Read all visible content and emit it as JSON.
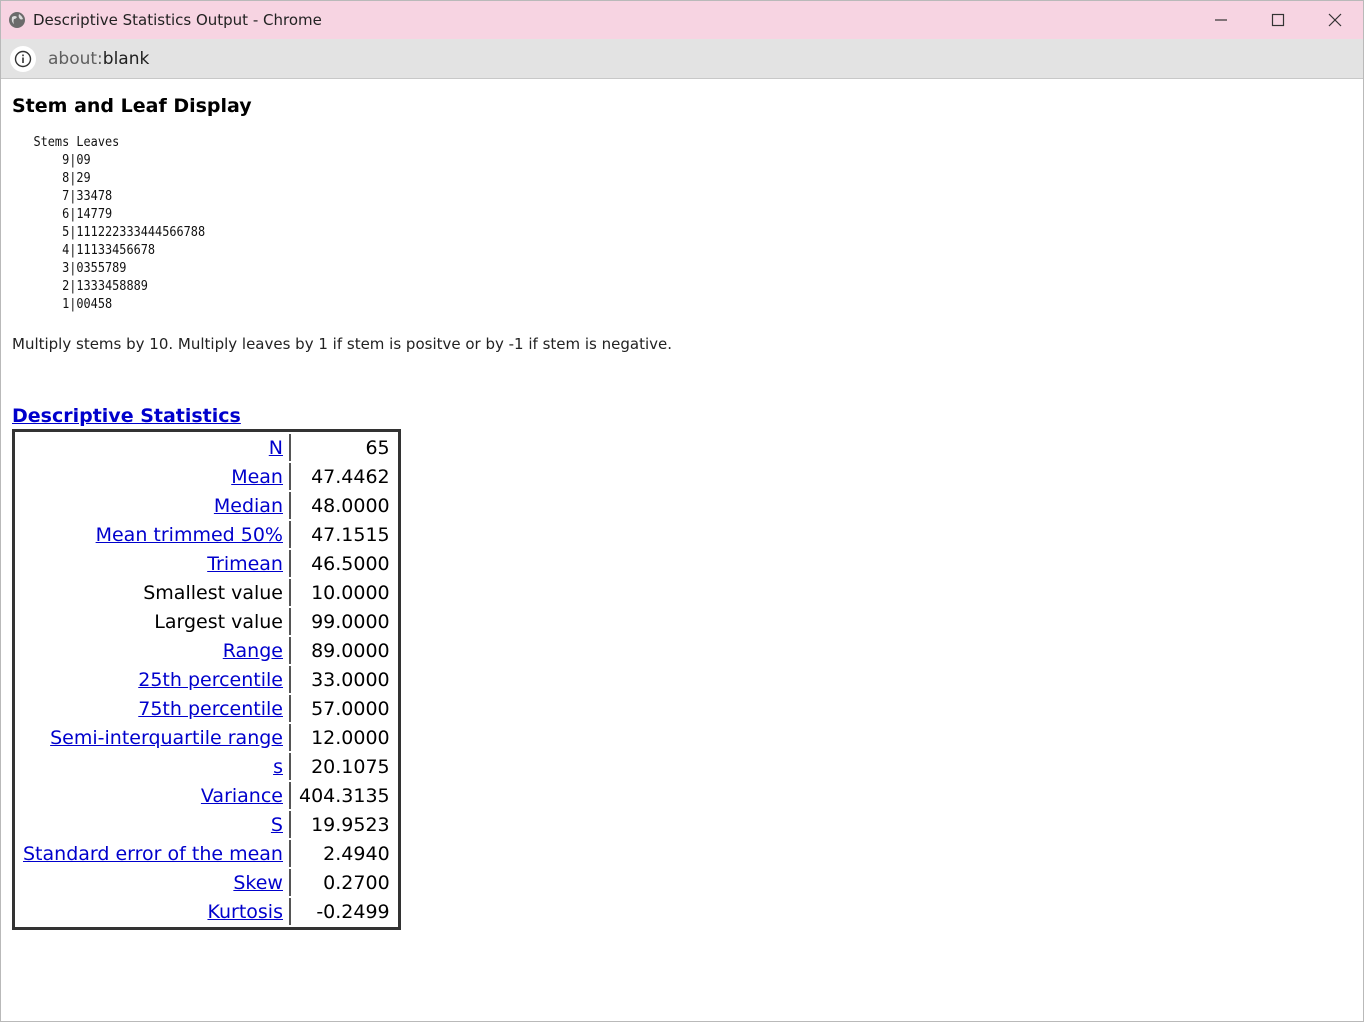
{
  "window": {
    "title": "Descriptive Statistics Output - Chrome",
    "controls": {
      "minimize": "minimize",
      "maximize": "maximize",
      "close": "close"
    }
  },
  "address": {
    "scheme": "about:",
    "host": "blank"
  },
  "stem_leaf": {
    "title": "Stem and Leaf Display",
    "header": "Stems Leaves",
    "rows": [
      {
        "stem": "9",
        "leaves": "09"
      },
      {
        "stem": "8",
        "leaves": "29"
      },
      {
        "stem": "7",
        "leaves": "33478"
      },
      {
        "stem": "6",
        "leaves": "14779"
      },
      {
        "stem": "5",
        "leaves": "111222333444566788"
      },
      {
        "stem": "4",
        "leaves": "11133456678"
      },
      {
        "stem": "3",
        "leaves": "0355789"
      },
      {
        "stem": "2",
        "leaves": "1333458889"
      },
      {
        "stem": "1",
        "leaves": "00458"
      }
    ],
    "note": "Multiply stems by 10. Multiply leaves by 1 if stem is positve or by -1 if stem is negative."
  },
  "descriptive": {
    "title": "Descriptive Statistics",
    "rows": [
      {
        "label": "N",
        "value": "65",
        "link": true
      },
      {
        "label": "Mean",
        "value": "47.4462",
        "link": true
      },
      {
        "label": "Median",
        "value": "48.0000",
        "link": true
      },
      {
        "label": "Mean trimmed 50%",
        "value": "47.1515",
        "link": true
      },
      {
        "label": "Trimean",
        "value": "46.5000",
        "link": true
      },
      {
        "label": "Smallest value",
        "value": "10.0000",
        "link": false
      },
      {
        "label": "Largest value",
        "value": "99.0000",
        "link": false
      },
      {
        "label": "Range",
        "value": "89.0000",
        "link": true
      },
      {
        "label": "25th percentile",
        "value": "33.0000",
        "link": true
      },
      {
        "label": "75th percentile",
        "value": "57.0000",
        "link": true
      },
      {
        "label": "Semi-interquartile range",
        "value": "12.0000",
        "link": true
      },
      {
        "label": "s",
        "value": "20.1075",
        "link": true
      },
      {
        "label": "Variance",
        "value": "404.3135",
        "link": true
      },
      {
        "label": "S",
        "value": "19.9523",
        "link": true
      },
      {
        "label": "Standard error of the mean",
        "value": "2.4940",
        "link": true
      },
      {
        "label": "Skew",
        "value": "0.2700",
        "link": true
      },
      {
        "label": "Kurtosis",
        "value": "-0.2499",
        "link": true
      }
    ]
  },
  "colors": {
    "titlebar": "#f7d4e2",
    "link": "#0000cc",
    "addressbar": "#e3e3e3"
  }
}
